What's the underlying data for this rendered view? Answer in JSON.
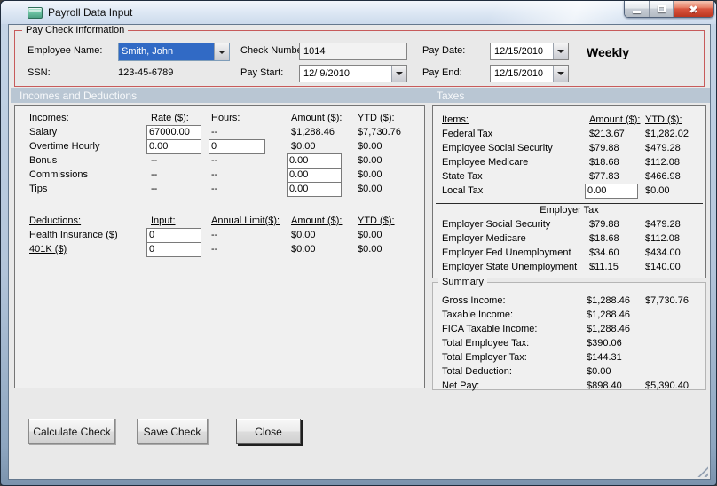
{
  "window": {
    "title": "Payroll Data Input"
  },
  "icons": {
    "app_icon": "form-window-icon",
    "minimize": "minimize-bar",
    "maximize": "restore-square",
    "close": "close-x",
    "dropdown": "down-arrow",
    "resize": "resize-grip"
  },
  "colors": {
    "group_border_red": "#c75b5b",
    "section_band": "#b9c6d3",
    "selection_blue": "#316ac5",
    "close_button_red": "#d9553f",
    "client_bg": "#e9e9e9",
    "panel_bg": "#f0f0f0"
  },
  "paycheck": {
    "group_title": "Pay Check Information",
    "employee_name": {
      "label": "Employee Name:",
      "value": "Smith, John"
    },
    "ssn": {
      "label": "SSN:",
      "value": "123-45-6789"
    },
    "check_number": {
      "label": "Check Number:",
      "value": "1014"
    },
    "pay_start": {
      "label": "Pay Start:",
      "value": "12/ 9/2010"
    },
    "pay_date": {
      "label": "Pay Date:",
      "value": "12/15/2010"
    },
    "pay_end": {
      "label": "Pay End:",
      "value": "12/15/2010"
    },
    "frequency": "Weekly"
  },
  "section_headers": {
    "left": "Incomes and Deductions",
    "right": "Taxes"
  },
  "incomes": {
    "headers": {
      "item": "Incomes:",
      "rate": "Rate ($):",
      "hours": "Hours:",
      "amount": "Amount ($):",
      "ytd": "YTD ($):"
    },
    "salary": {
      "label": "Salary",
      "rate": "67000.00",
      "hours": "--",
      "amount": "$1,288.46",
      "ytd": "$7,730.76"
    },
    "overtime": {
      "label": "Overtime Hourly",
      "rate": "0.00",
      "hours": "0",
      "amount": "$0.00",
      "ytd": "$0.00"
    },
    "bonus": {
      "label": "Bonus",
      "rate": "--",
      "hours": "--",
      "amount": "0.00",
      "ytd": "$0.00"
    },
    "commissions": {
      "label": "Commissions",
      "rate": "--",
      "hours": "--",
      "amount": "0.00",
      "ytd": "$0.00"
    },
    "tips": {
      "label": "Tips",
      "rate": "--",
      "hours": "--",
      "amount": "0.00",
      "ytd": "$0.00"
    }
  },
  "deductions": {
    "headers": {
      "item": "Deductions:",
      "input": "Input:",
      "limit": "Annual Limit($):",
      "amount": "Amount ($):",
      "ytd": "YTD ($):"
    },
    "health": {
      "label": "Health Insurance ($)",
      "input": "0",
      "limit": "--",
      "amount": "$0.00",
      "ytd": "$0.00"
    },
    "k401": {
      "label": "401K ($)",
      "input": "0",
      "limit": "--",
      "amount": "$0.00",
      "ytd": "$0.00"
    }
  },
  "taxes": {
    "headers": {
      "item": "Items:",
      "amount": "Amount ($):",
      "ytd": "YTD ($):"
    },
    "federal": {
      "label": "Federal Tax",
      "amount": "$213.67",
      "ytd": "$1,282.02"
    },
    "emp_ss": {
      "label": "Employee Social Security",
      "amount": "$79.88",
      "ytd": "$479.28"
    },
    "emp_medicare": {
      "label": "Employee Medicare",
      "amount": "$18.68",
      "ytd": "$112.08"
    },
    "state": {
      "label": "State Tax",
      "amount": "$77.83",
      "ytd": "$466.98"
    },
    "local": {
      "label": "Local Tax",
      "amount": "0.00",
      "ytd": "$0.00"
    },
    "employer_header": "Employer Tax",
    "empr_ss": {
      "label": "Employer Social Security",
      "amount": "$79.88",
      "ytd": "$479.28"
    },
    "empr_medicare": {
      "label": "Employer Medicare",
      "amount": "$18.68",
      "ytd": "$112.08"
    },
    "empr_fed_unemp": {
      "label": "Employer Fed Unemployment",
      "amount": "$34.60",
      "ytd": "$434.00"
    },
    "empr_state_unemp": {
      "label": "Employer State Unemployment",
      "amount": "$11.15",
      "ytd": "$140.00"
    }
  },
  "summary": {
    "group_title": "Summary",
    "gross": {
      "label": "Gross Income:",
      "amount": "$1,288.46",
      "ytd": "$7,730.76"
    },
    "taxable": {
      "label": "Taxable Income:",
      "amount": "$1,288.46",
      "ytd": ""
    },
    "fica": {
      "label": "FICA Taxable Income:",
      "amount": "$1,288.46",
      "ytd": ""
    },
    "total_emp_tax": {
      "label": "Total Employee Tax:",
      "amount": "$390.06",
      "ytd": ""
    },
    "total_empr_tax": {
      "label": "Total Employer Tax:",
      "amount": "$144.31",
      "ytd": ""
    },
    "total_deduction": {
      "label": "Total Deduction:",
      "amount": "$0.00",
      "ytd": ""
    },
    "net_pay": {
      "label": "Net Pay:",
      "amount": "$898.40",
      "ytd": "$5,390.40"
    }
  },
  "buttons": {
    "calculate": "Calculate Check",
    "save": "Save Check",
    "close": "Close"
  }
}
